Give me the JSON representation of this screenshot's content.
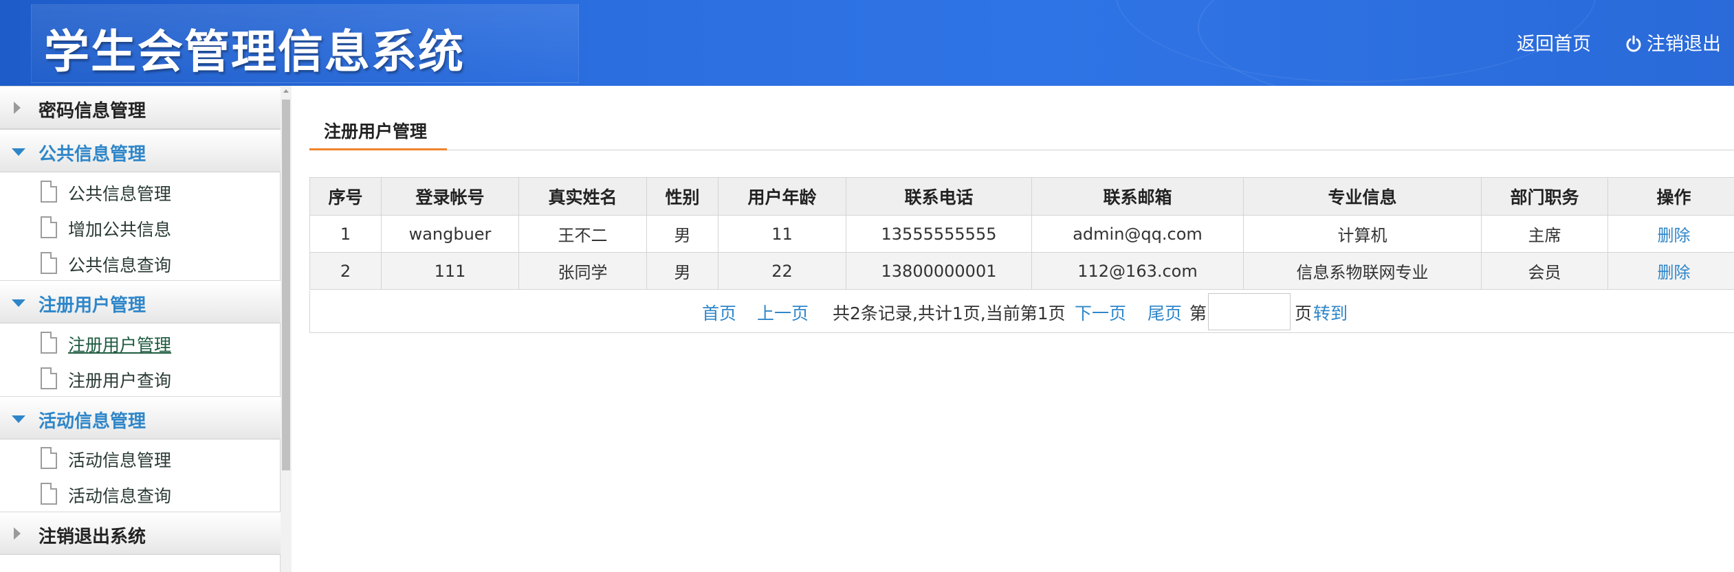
{
  "header": {
    "app_title": "学生会管理信息系统",
    "home_link": "返回首页",
    "logout_link": "注销退出"
  },
  "sidebar": {
    "groups": [
      {
        "label": "密码信息管理",
        "expanded": false,
        "items": []
      },
      {
        "label": "公共信息管理",
        "expanded": true,
        "items": [
          "公共信息管理",
          "增加公共信息",
          "公共信息查询"
        ]
      },
      {
        "label": "注册用户管理",
        "expanded": true,
        "items": [
          "注册用户管理",
          "注册用户查询"
        ],
        "active_item": "注册用户管理"
      },
      {
        "label": "活动信息管理",
        "expanded": true,
        "items": [
          "活动信息管理",
          "活动信息查询"
        ]
      },
      {
        "label": "注销退出系统",
        "expanded": false,
        "items": []
      }
    ]
  },
  "main": {
    "tab_label": "注册用户管理",
    "table": {
      "headers": [
        "序号",
        "登录帐号",
        "真实姓名",
        "性别",
        "用户年龄",
        "联系电话",
        "联系邮箱",
        "专业信息",
        "部门职务",
        "操作"
      ],
      "rows": [
        [
          "1",
          "wangbuer",
          "王不二",
          "男",
          "11",
          "13555555555",
          "admin@qq.com",
          "计算机",
          "主席",
          "删除"
        ],
        [
          "2",
          "111",
          "张同学",
          "男",
          "22",
          "13800000001",
          "112@163.com",
          "信息系物联网专业",
          "会员",
          "删除"
        ]
      ]
    },
    "pager": {
      "first": "首页",
      "prev": "上一页",
      "summary": "共2条记录,共计1页,当前第1页",
      "next": "下一页",
      "last": "尾页",
      "page_prefix": "第",
      "page_input_value": "",
      "page_suffix": "页",
      "go": "转到"
    }
  },
  "colors": {
    "header_blue": "#2b6ee0",
    "link_blue": "#2e86c9",
    "tab_underline": "#f0822a"
  }
}
